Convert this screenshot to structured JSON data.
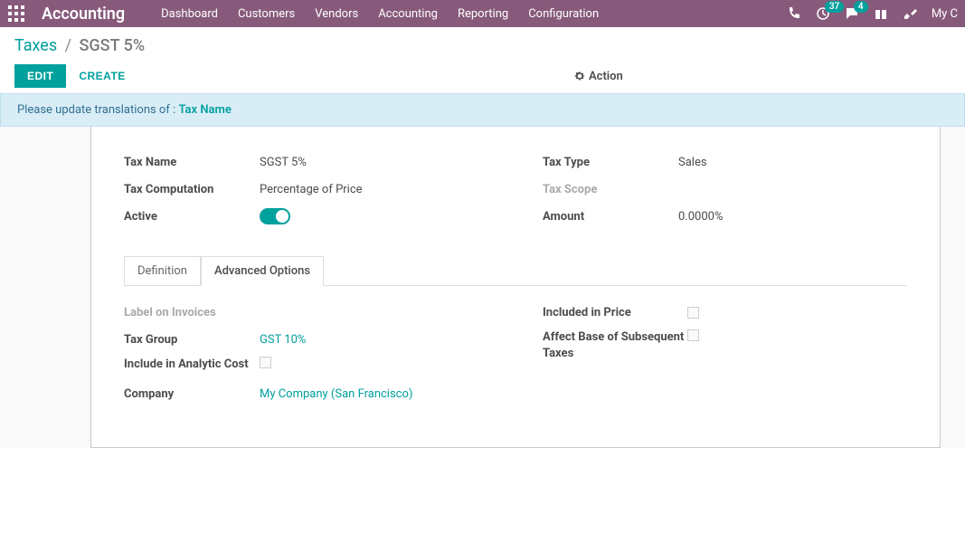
{
  "navbar": {
    "brand": "Accounting",
    "menu": [
      "Dashboard",
      "Customers",
      "Vendors",
      "Accounting",
      "Reporting",
      "Configuration"
    ],
    "activity_badge": "37",
    "messages_badge": "4",
    "user": "My C"
  },
  "breadcrumb": {
    "parent": "Taxes",
    "current": "SGST 5%"
  },
  "buttons": {
    "edit": "EDIT",
    "create": "CREATE",
    "action": "Action"
  },
  "alert": {
    "prefix": "Please update translations of : ",
    "link": "Tax Name"
  },
  "form": {
    "left": {
      "tax_name_label": "Tax Name",
      "tax_name_value": "SGST 5%",
      "tax_computation_label": "Tax Computation",
      "tax_computation_value": "Percentage of Price",
      "active_label": "Active"
    },
    "right": {
      "tax_type_label": "Tax Type",
      "tax_type_value": "Sales",
      "tax_scope_label": "Tax Scope",
      "tax_scope_value": "",
      "amount_label": "Amount",
      "amount_value": "0.0000%"
    }
  },
  "tabs": {
    "definition": "Definition",
    "advanced": "Advanced Options"
  },
  "advanced": {
    "left": {
      "label_invoices_label": "Label on Invoices",
      "label_invoices_value": "",
      "tax_group_label": "Tax Group",
      "tax_group_value": "GST 10%",
      "include_analytic_label": "Include in Analytic Cost",
      "company_label": "Company",
      "company_value": "My Company (San Francisco)"
    },
    "right": {
      "included_price_label": "Included in Price",
      "affect_base_label": "Affect Base of Subsequent Taxes"
    }
  }
}
